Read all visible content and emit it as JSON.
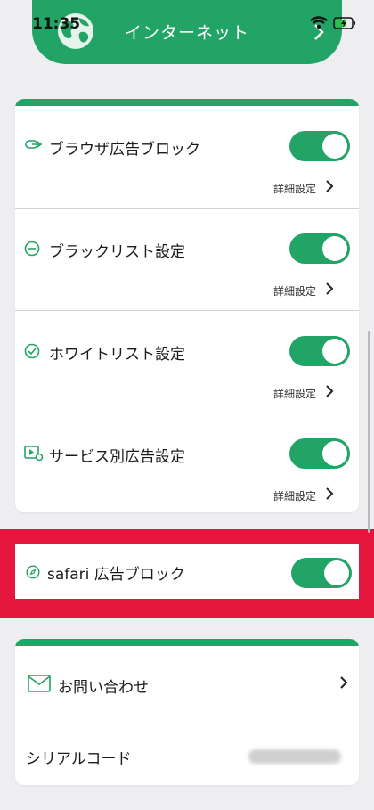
{
  "status": {
    "time": "11:35"
  },
  "header": {
    "title": "インターネット"
  },
  "ad_settings": {
    "rows": [
      {
        "title": "ブラウザ広告ブロック",
        "icon": "link-icon",
        "toggle_on": true,
        "detail_label": "詳細設定"
      },
      {
        "title": "ブラックリスト設定",
        "icon": "minus-circle-icon",
        "toggle_on": true,
        "detail_label": "詳細設定"
      },
      {
        "title": "ホワイトリスト設定",
        "icon": "check-circle-icon",
        "toggle_on": true,
        "detail_label": "詳細設定"
      },
      {
        "title": "サービス別広告設定",
        "icon": "video-settings-icon",
        "toggle_on": true,
        "detail_label": "詳細設定"
      }
    ]
  },
  "safari": {
    "title": "safari 広告ブロック",
    "icon": "compass-icon",
    "toggle_on": true
  },
  "support": {
    "contact_label": "お問い合わせ",
    "serial_label": "シリアルコード"
  },
  "colors": {
    "accent": "#21a466",
    "highlight": "#e5173f",
    "background": "#eeeef1"
  }
}
